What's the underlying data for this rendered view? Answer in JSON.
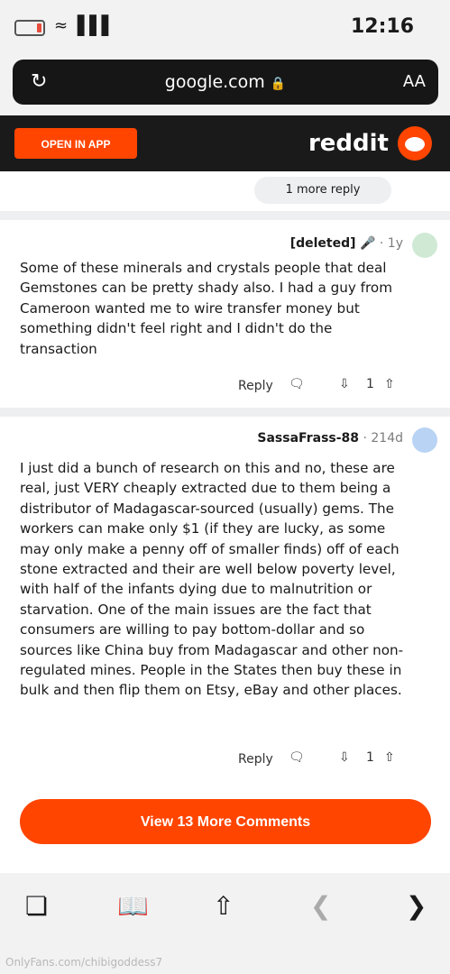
{
  "status_bar": {
    "time": "12:16"
  },
  "browser": {
    "url": "google.com",
    "aa_label": "AA"
  },
  "reddit": {
    "logo_text": "reddit",
    "open_in_app": "OPEN IN APP"
  },
  "thread": {
    "more_reply": "1 more reply",
    "comments": [
      {
        "username": "[deleted]",
        "badge_icon": "mic-icon",
        "age": "1y",
        "body": "Some of these minerals and crystals people that deal Gemstones can be pretty shady also. I had a guy from Cameroon wanted me to wire transfer money but something didn't feel right and I didn't do the transaction",
        "votes": "1",
        "reply_label": "Reply"
      },
      {
        "username": "SassaFrass-88",
        "age": "214d",
        "body": "I just did a bunch of research on this and no, these are real, just VERY cheaply extracted due to them being a distributor of Madagascar-sourced (usually) gems. The workers can make only $1 (if they are lucky, as some may only make a penny off of smaller finds) off of each stone extracted and their are well below poverty level, with half of the infants dying due to malnutrition or starvation. One of the main issues are the fact that consumers are willing to pay bottom-dollar and so sources like China buy from Madagascar and other non-regulated mines. People in the States then buy these in bulk and then flip them on Etsy, eBay and other places.",
        "votes": "1",
        "reply_label": "Reply"
      }
    ],
    "view_more": "View 13 More Comments"
  },
  "watermark": "OnlyFans.com/chibigoddess7",
  "colors": {
    "accent": "#ff4500",
    "header_bg": "#1a1a1b",
    "url_bar_bg": "#161617"
  }
}
